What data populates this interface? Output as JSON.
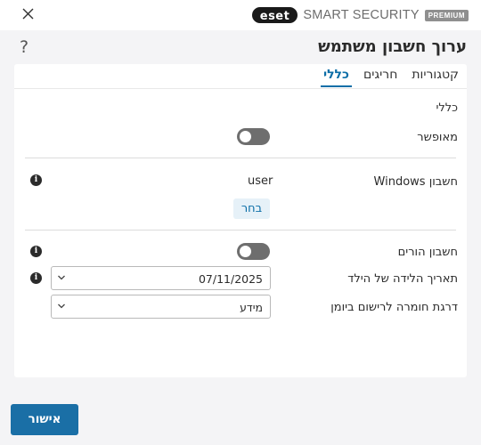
{
  "window": {
    "brand_logo": "eset",
    "brand_name": "SMART SECURITY",
    "brand_edition": "PREMIUM"
  },
  "header": {
    "title": "ערוך חשבון משתמש",
    "help_label": "?"
  },
  "tabs": [
    {
      "label": "כללי",
      "active": true
    },
    {
      "label": "חריגים",
      "active": false
    },
    {
      "label": "קטגוריות",
      "active": false
    }
  ],
  "general": {
    "section_label": "כללי",
    "enabled_label": "מאופשר",
    "enabled": false,
    "windows_account_label": "חשבון Windows",
    "windows_account_value": "user",
    "choose_button": "בחר",
    "parent_account_label": "חשבון הורים",
    "parent_account": false,
    "birthdate_label": "תאריך הלידה של הילד",
    "birthdate_value": "07/11/2025",
    "log_severity_label": "דרגת חומרה לרישום ביומן",
    "log_severity_value": "מידע"
  },
  "footer": {
    "ok_button": "אישור"
  },
  "colors": {
    "accent": "#0c6ea7",
    "ok_button": "#1a6fa6",
    "toggle_off": "#6e6e6e"
  }
}
